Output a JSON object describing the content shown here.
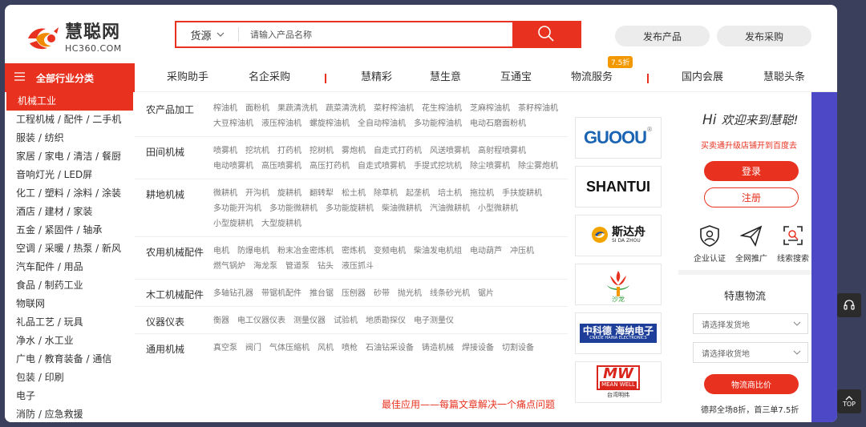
{
  "logo": {
    "cn": "慧聪网",
    "en": "HC360.COM"
  },
  "search": {
    "type_label": "货源",
    "placeholder": "请输入产品名称"
  },
  "header_buttons": {
    "publish_product": "发布产品",
    "publish_purchase": "发布采购"
  },
  "category_header": {
    "icon": "menu-icon",
    "label": "全部行业分类"
  },
  "nav": {
    "items": [
      "采购助手",
      "名企采购",
      "慧精彩",
      "慧生意",
      "互通宝",
      "物流服务",
      "国内会展",
      "慧聪头条"
    ],
    "badge": "7.5折"
  },
  "sidebar": {
    "items": [
      "机械工业",
      "工程机械 / 配件 / 二手机",
      "服装 / 纺织",
      "家居 / 家电 / 清洁 / 餐厨",
      "音响灯光 / LED屏",
      "化工 / 塑料 / 涂料 / 涂装",
      "酒店 / 建材 / 家装",
      "五金 / 紧固件 / 轴承",
      "空调 / 采暖 / 热泵 / 新风",
      "汽车配件 / 用品",
      "食品 / 制药工业",
      "物联网",
      "礼品工艺 / 玩具",
      "净水 / 水工业",
      "广电 / 教育装备 / 通信",
      "包装 / 印刷",
      "电子",
      "消防 / 应急救援"
    ]
  },
  "categories": [
    {
      "title": "农产品加工",
      "links": [
        "榨油机",
        "面粉机",
        "果蔬清洗机",
        "蔬菜清洗机",
        "菜籽榨油机",
        "花生榨油机",
        "芝麻榨油机",
        "茶籽榨油机",
        "大豆榨油机",
        "液压榨油机",
        "螺旋榨油机",
        "全自动榨油机",
        "多功能榨油机",
        "电动石磨面粉机"
      ]
    },
    {
      "title": "田间机械",
      "links": [
        "喷雾机",
        "挖坑机",
        "打药机",
        "挖树机",
        "雾炮机",
        "自走式打药机",
        "风送喷雾机",
        "高射程喷雾机",
        "电动喷雾机",
        "高压喷雾机",
        "高压打药机",
        "自走式喷雾机",
        "手提式挖坑机",
        "除尘喷雾机",
        "除尘雾炮机"
      ]
    },
    {
      "title": "耕地机械",
      "links": [
        "微耕机",
        "开沟机",
        "旋耕机",
        "翻转犁",
        "松土机",
        "除草机",
        "起垄机",
        "培土机",
        "拖拉机",
        "手扶旋耕机",
        "多功能开沟机",
        "多功能微耕机",
        "多功能旋耕机",
        "柴油微耕机",
        "汽油微耕机",
        "小型微耕机",
        "小型旋耕机",
        "大型旋耕机"
      ]
    },
    {
      "title": "农用机械配件",
      "links": [
        "电机",
        "防爆电机",
        "粉末冶金密炼机",
        "密炼机",
        "变频电机",
        "柴油发电机组",
        "电动葫芦",
        "冲压机",
        "燃气锅炉",
        "海龙泵",
        "管道泵",
        "钻头",
        "液压抓斗"
      ]
    },
    {
      "title": "木工机械配件",
      "links": [
        "多轴钻孔器",
        "带锯机配件",
        "推台锯",
        "压刨器",
        "砂带",
        "抛光机",
        "线条砂光机",
        "锯片"
      ]
    },
    {
      "title": "仪器仪表",
      "links": [
        "衡器",
        "电工仪器仪表",
        "测量仪器",
        "试验机",
        "地质勘探仪",
        "电子测量仪"
      ]
    },
    {
      "title": "通用机械",
      "links": [
        "真空泵",
        "阀门",
        "气体压缩机",
        "风机",
        "喷枪",
        "石油钻采设备",
        "铸造机械",
        "焊接设备",
        "切割设备"
      ]
    }
  ],
  "promo": "最佳应用——每篇文章解决一个痛点问题",
  "brands": [
    {
      "text": "GUOOU",
      "mark": "®"
    },
    {
      "text": "SHANTUI"
    },
    {
      "text": "斯达舟",
      "sub": "SI DA ZHOU"
    },
    {
      "text": "沙龙"
    },
    {
      "text": "中科德 海纳电子",
      "sub": "CNKDE HAINA ELECTRONICS"
    },
    {
      "text": "MW",
      "sub": "MEAN WELL",
      "sub2": "台湾明纬"
    }
  ],
  "right": {
    "hi": "Hi",
    "welcome": "欢迎来到慧聪!",
    "sub": "买卖通升级店铺开到百度去",
    "login": "登录",
    "register": "注册",
    "features": [
      {
        "icon": "shield-user-icon",
        "label": "企业认证"
      },
      {
        "icon": "paper-plane-icon",
        "label": "全网推广"
      },
      {
        "icon": "scan-search-icon",
        "label": "线索搜索"
      }
    ],
    "logistics_title": "特惠物流",
    "from_placeholder": "请选择发货地",
    "to_placeholder": "请选择收货地",
    "compare": "物流商比价",
    "discount": "德邦全场8折，首三单7.5折"
  },
  "float": {
    "top": "TOP"
  },
  "colors": {
    "accent": "#e8321f",
    "strip": "#4d49c6",
    "badge": "#f39800"
  }
}
